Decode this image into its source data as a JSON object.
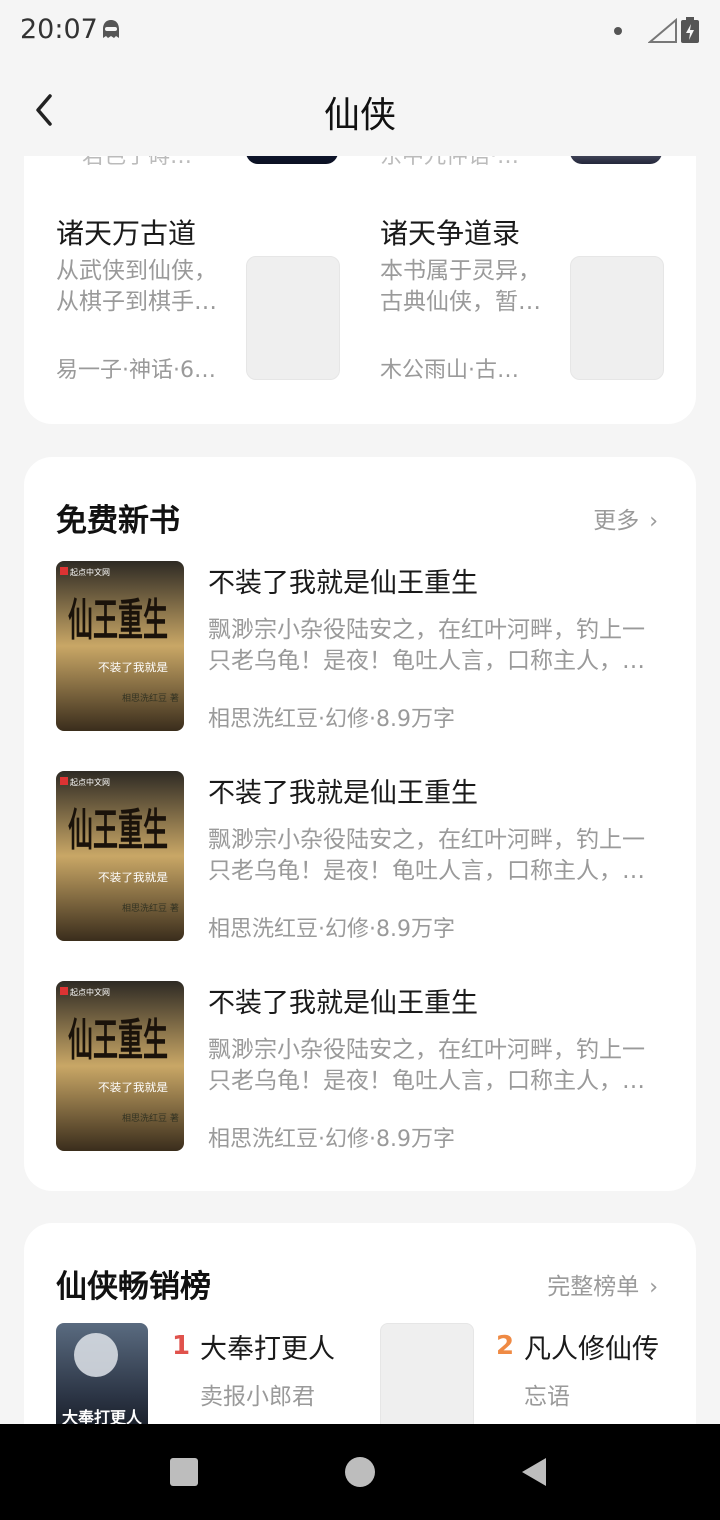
{
  "status": {
    "time": "20:07"
  },
  "header": {
    "title": "仙侠"
  },
  "top_grid": {
    "items": [
      {
        "title": "诸天万古道",
        "desc1": "从武侠到仙侠，",
        "desc2": "从棋子到棋手…",
        "meta": "易一子·神话·6…"
      },
      {
        "title": "诸天争道录",
        "desc1": "本书属于灵异，",
        "desc2": "古典仙侠，暂…",
        "meta": "木公雨山·古…"
      }
    ],
    "cut_off": [
      {
        "meta": "君色子碍…"
      },
      {
        "meta": "东中九仲语·…"
      }
    ]
  },
  "free_new": {
    "title": "免费新书",
    "more": "更多",
    "books": [
      {
        "title": "不装了我就是仙王重生",
        "desc1": "飘渺宗小杂役陆安之，在红叶河畔，钓上一",
        "desc2": "只老乌龟！是夜！龟吐人言，口称主人，…",
        "meta": "相思洗红豆·幻修·8.9万字"
      },
      {
        "title": "不装了我就是仙王重生",
        "desc1": "飘渺宗小杂役陆安之，在红叶河畔，钓上一",
        "desc2": "只老乌龟！是夜！龟吐人言，口称主人，…",
        "meta": "相思洗红豆·幻修·8.9万字"
      },
      {
        "title": "不装了我就是仙王重生",
        "desc1": "飘渺宗小杂役陆安之，在红叶河畔，钓上一",
        "desc2": "只老乌龟！是夜！龟吐人言，口称主人，…",
        "meta": "相思洗红豆·幻修·8.9万字"
      }
    ],
    "cover_text": {
      "big": "仙王重生",
      "sub": "不装了我就是",
      "publisher": "起点中文网",
      "author": "相思洗红豆 著"
    }
  },
  "bestseller": {
    "title": "仙侠畅销榜",
    "more": "完整榜单",
    "items": [
      {
        "rank": "1",
        "title": "大奉打更人",
        "author": "卖报小郎君",
        "rank_color": "#e0524c",
        "cover_text": "大奉打更人"
      },
      {
        "rank": "2",
        "title": "凡人修仙传",
        "author": "忘语",
        "rank_color": "#ef8a44"
      }
    ]
  }
}
